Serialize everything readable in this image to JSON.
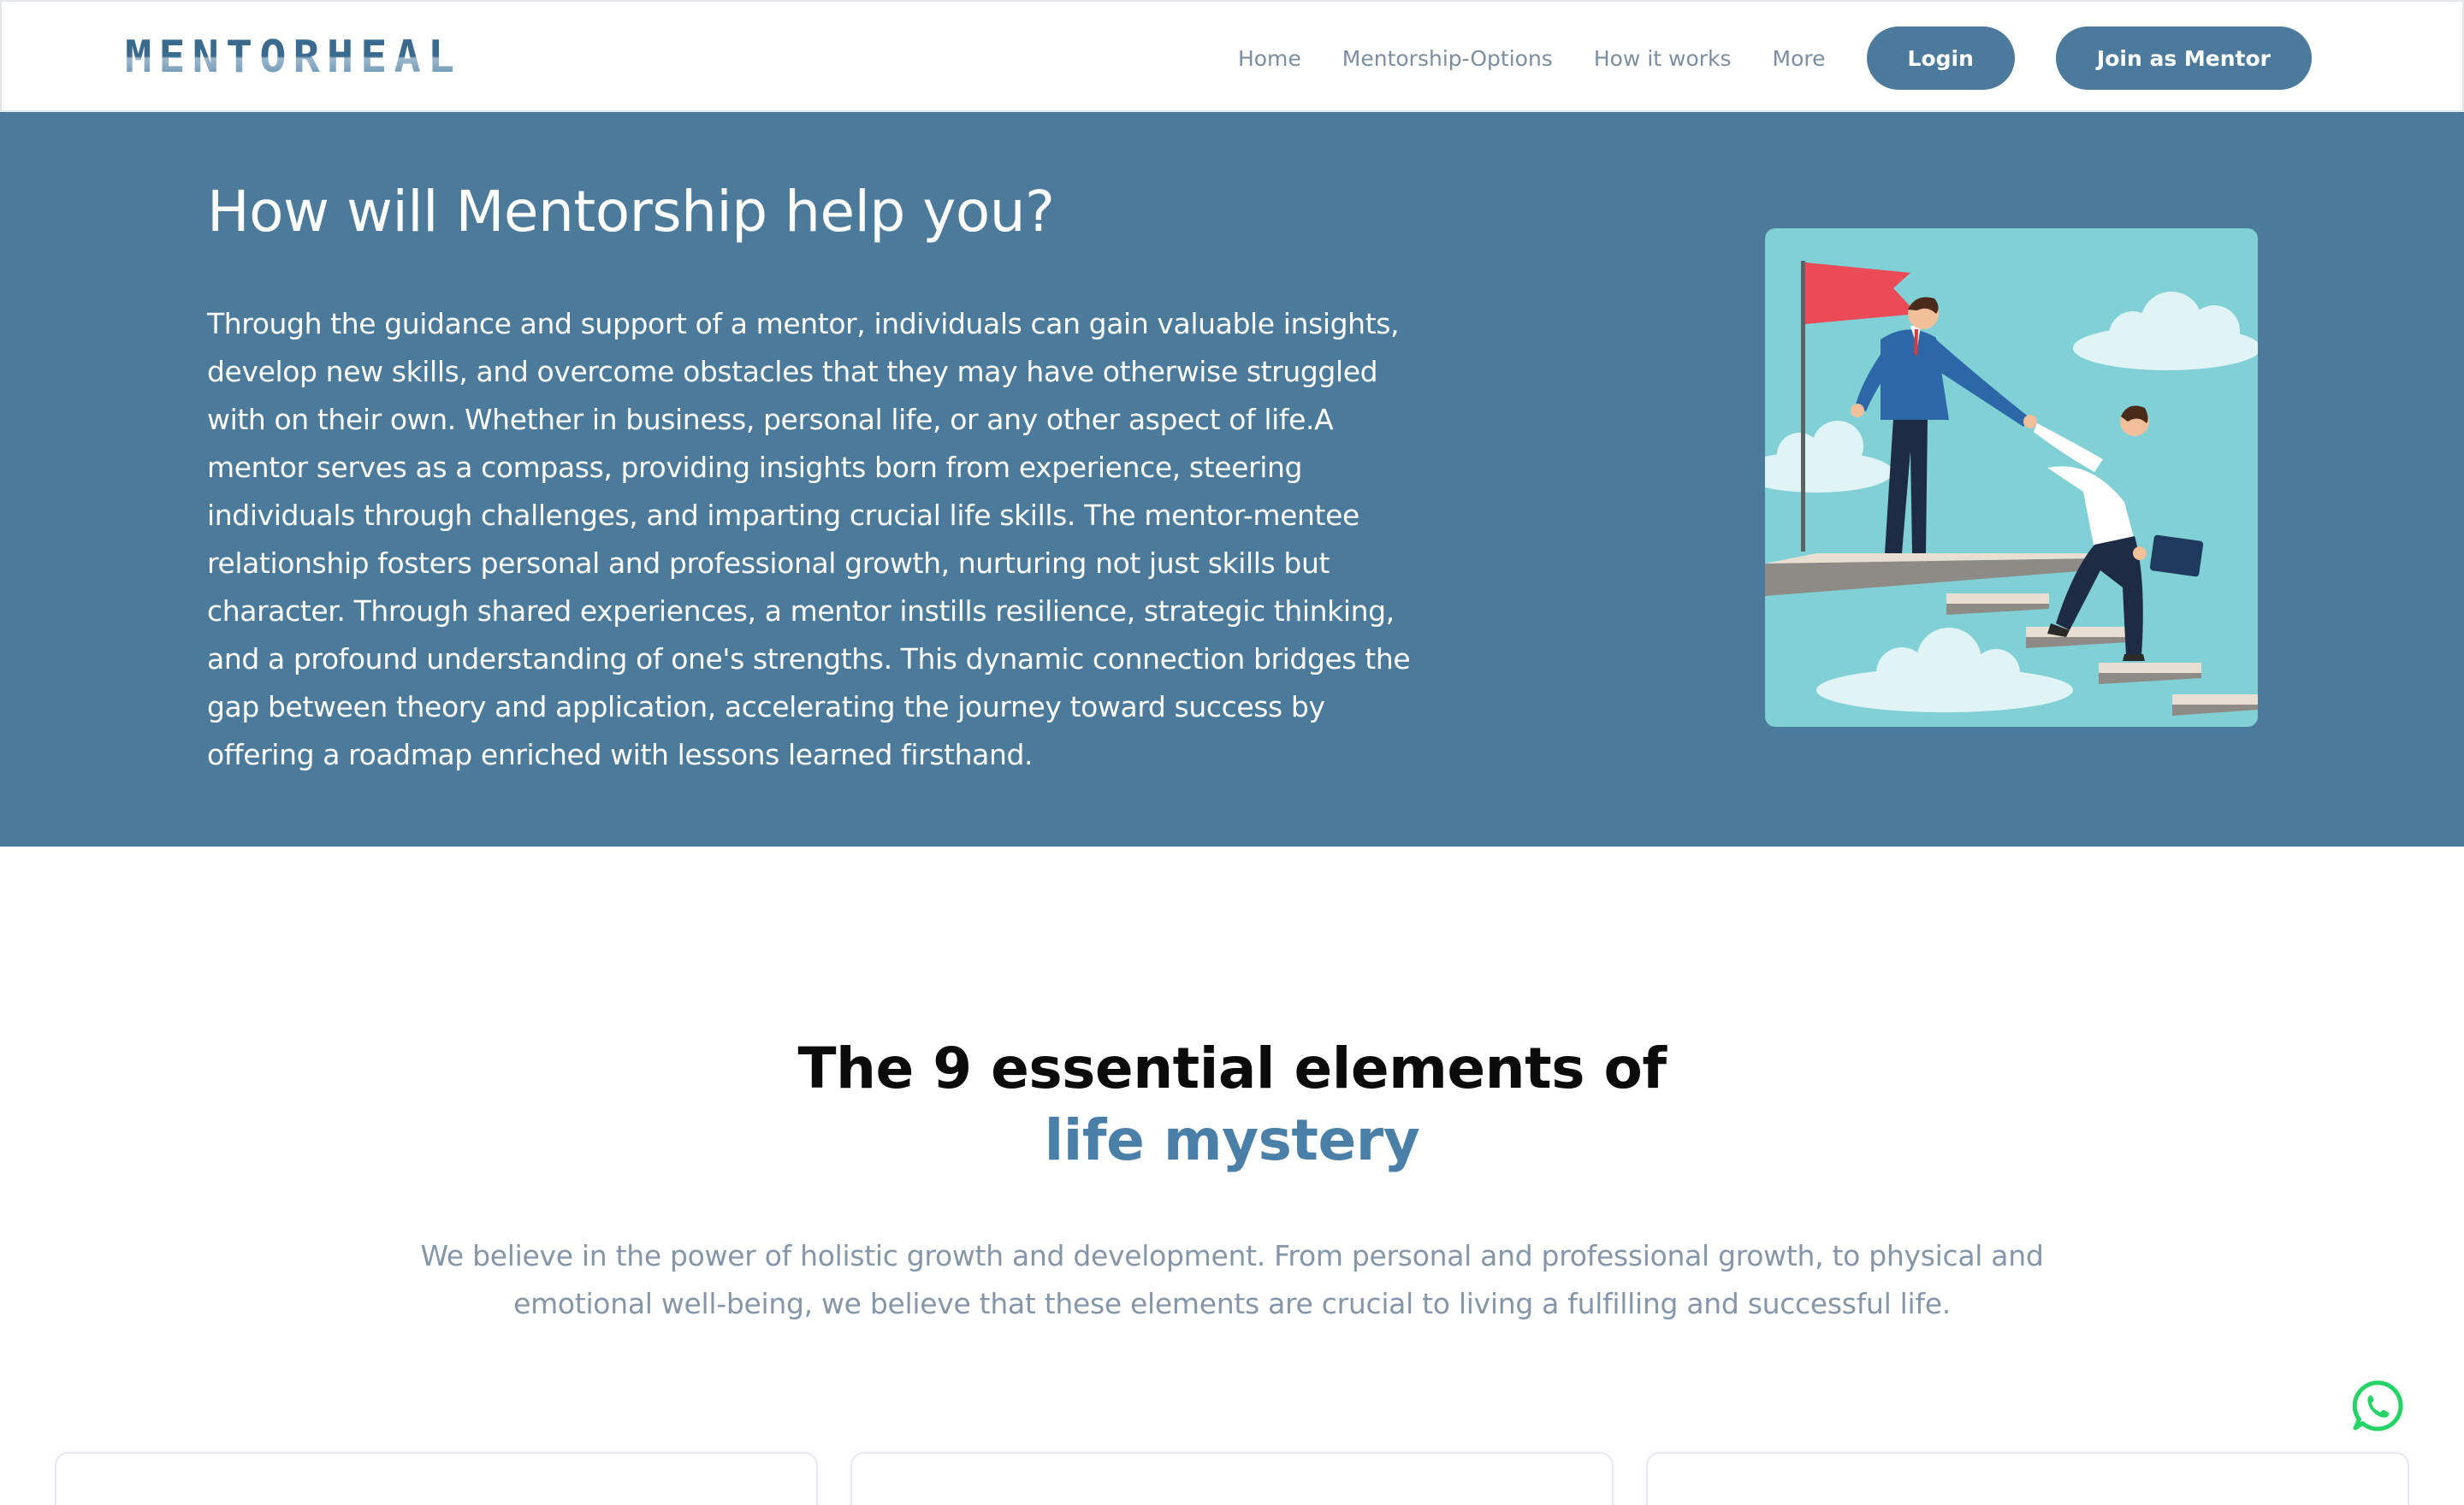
{
  "brand": {
    "logo_text": "MENTORHEAL"
  },
  "nav": {
    "links": [
      "Home",
      "Mentorship-Options",
      "How it works",
      "More"
    ],
    "login_label": "Login",
    "join_label": "Join as Mentor"
  },
  "hero": {
    "title": "How will Mentorship help you?",
    "body": "Through the guidance and support of a mentor, individuals can gain valuable insights, develop new skills, and overcome obstacles that they may have otherwise struggled with on their own. Whether in business, personal life, or any other aspect of life.A mentor serves as a compass, providing insights born from experience, steering individuals through challenges, and imparting crucial life skills. The mentor-mentee relationship fosters personal and professional growth, nurturing not just skills but character. Through shared experiences, a mentor instills resilience, strategic thinking, and a profound understanding of one's strengths. This dynamic connection bridges the gap between theory and application, accelerating the journey toward success by offering a roadmap enriched with lessons learned firsthand."
  },
  "elements": {
    "title_line1": "The 9 essential elements of",
    "title_accent": "life mystery",
    "description": "We believe in the power of holistic growth and development. From personal and professional growth, to physical and emotional well-being, we believe that these elements are crucial to living a fulfilling and successful life."
  },
  "colors": {
    "brand_blue": "#4b7a9b",
    "button_blue": "#4b7a9c",
    "accent_text": "#4a7fa7",
    "muted_text": "#8496a8",
    "whatsapp_green": "#25d366"
  },
  "icons": {
    "whatsapp": "whatsapp-icon"
  }
}
